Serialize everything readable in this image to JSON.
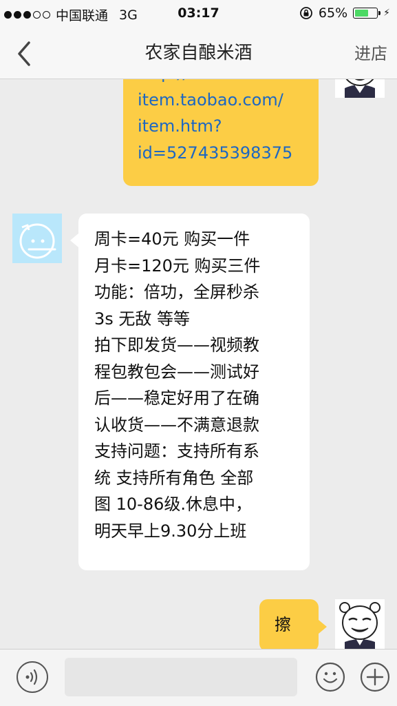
{
  "status_bar": {
    "carrier": "中国联通",
    "network": "3G",
    "time": "03:17",
    "battery_percent": "65%",
    "battery_level": 0.65,
    "signal_bars_filled": 3,
    "signal_bars_total": 5
  },
  "nav": {
    "title": "农家自酿米酒",
    "right_label": "进店"
  },
  "messages": [
    {
      "direction": "outgoing",
      "lines": [
        "http://",
        "item.taobao.com/",
        "item.htm?",
        "id=527435398375"
      ]
    },
    {
      "direction": "incoming",
      "lines": [
        "周卡=40元 购买一件",
        "月卡=120元 购买三件",
        "功能：倍功，全屏秒杀",
        "3s 无敌 等等",
        "拍下即发货——视频教",
        "程包教包会——测试好",
        "后——稳定好用了在确",
        "认收货——不满意退款",
        "支持问题：支持所有系",
        "统 支持所有角色 全部",
        "图 10-86级.休息中，",
        "明天早上9.30分上班"
      ]
    },
    {
      "direction": "outgoing",
      "lines": [
        "擦"
      ]
    }
  ],
  "input": {
    "placeholder": "",
    "value": ""
  },
  "colors": {
    "outgoing_bubble": "#fccd45",
    "incoming_bubble": "#ffffff",
    "link": "#1d67c2",
    "background": "#ececec",
    "shop_avatar_bg": "#b9e7fb"
  },
  "icons": {
    "back": "chevron-left-icon",
    "voice": "voice-icon",
    "emoji": "smiley-icon",
    "more": "plus-icon",
    "lock": "rotation-lock-icon"
  }
}
